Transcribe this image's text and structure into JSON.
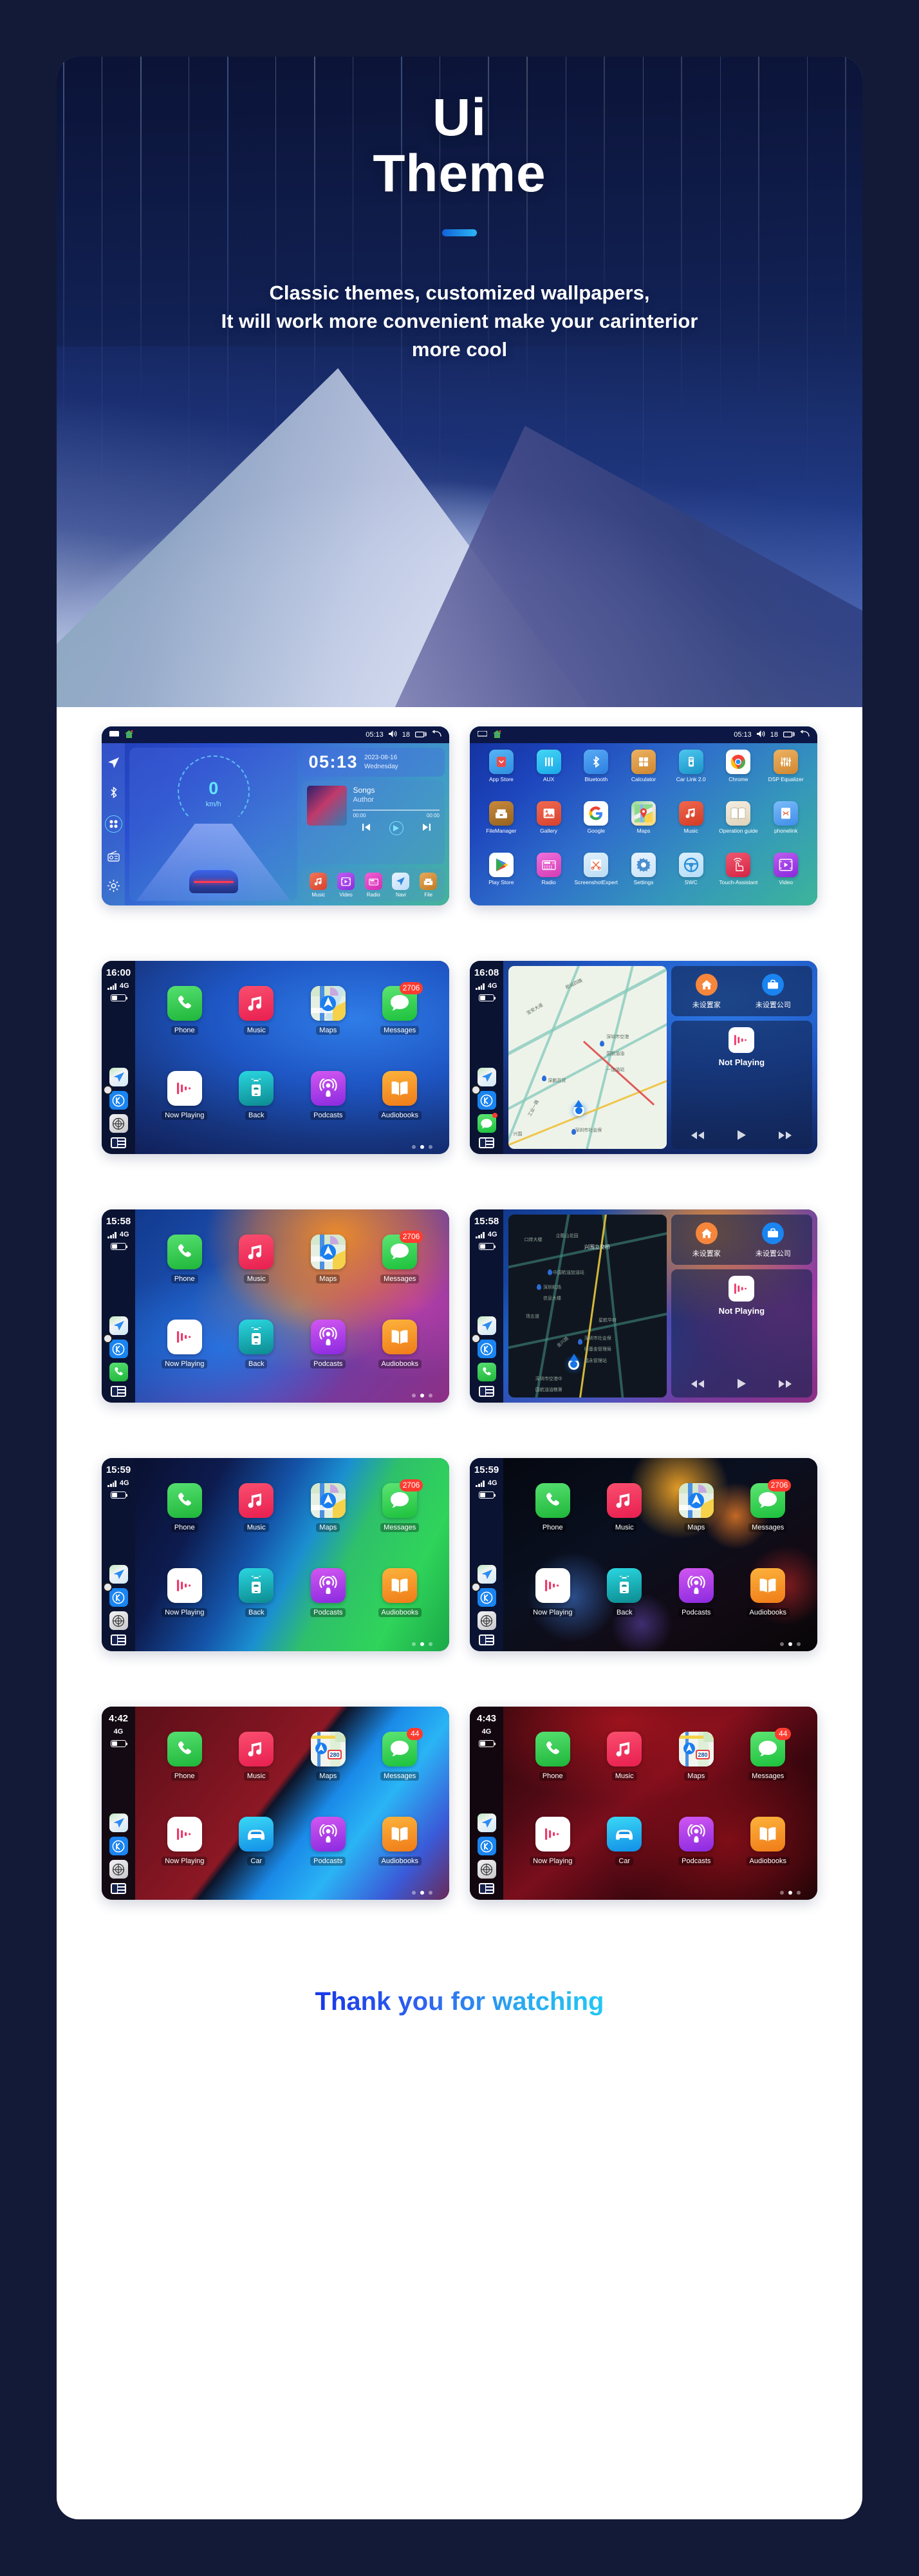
{
  "hero": {
    "title_line1": "Ui",
    "title_line2": "Theme",
    "subtitle_line1": "Classic themes, customized wallpapers,",
    "subtitle_line2": "It will work more convenient make your carinterior",
    "subtitle_line3": "more cool"
  },
  "headunit": {
    "status": {
      "time": "05:13",
      "volume": "18"
    },
    "gauge": {
      "speed": "0",
      "unit": "km/h"
    },
    "clock": {
      "time": "05:13",
      "date": "2023-08-16",
      "weekday": "Wednesday"
    },
    "music": {
      "title": "Songs",
      "artist": "Author",
      "elapsed": "00:00",
      "total": "00:00"
    },
    "dock": [
      {
        "label": "Music",
        "icon": "music-note-icon",
        "color": "#e8543c"
      },
      {
        "label": "Video",
        "icon": "video-icon",
        "color": "#a23ce8"
      },
      {
        "label": "Radio",
        "icon": "radio-icon",
        "color": "#e83cc8"
      },
      {
        "label": "Navi",
        "icon": "navigation-icon",
        "color": "#cfe9ff"
      },
      {
        "label": "File",
        "icon": "file-box-icon",
        "color": "#d8923c"
      }
    ]
  },
  "appgrid": {
    "status": {
      "time": "05:13",
      "volume": "18"
    },
    "apps": [
      {
        "label": "App Store",
        "icon": "app-store-icon",
        "color": "#4aa8f0"
      },
      {
        "label": "AUX",
        "icon": "aux-icon",
        "color": "#2ec4f0"
      },
      {
        "label": "Bluetooth",
        "icon": "bluetooth-icon",
        "color": "#3e9ef5"
      },
      {
        "label": "Calculator",
        "icon": "calculator-icon",
        "color": "#e09a47"
      },
      {
        "label": "Car Link 2.0",
        "icon": "car-link-icon",
        "color": "#35b7e8"
      },
      {
        "label": "Chrome",
        "icon": "chrome-icon",
        "color": "#ffffff"
      },
      {
        "label": "DSP Equalizer",
        "icon": "equalizer-icon",
        "color": "#e09a47"
      },
      {
        "label": "FileManager",
        "icon": "file-manager-icon",
        "color": "#b5762e"
      },
      {
        "label": "Gallery",
        "icon": "gallery-icon",
        "color": "#e8503c"
      },
      {
        "label": "Google",
        "icon": "google-icon",
        "color": "#ffffff"
      },
      {
        "label": "Maps",
        "icon": "maps-icon",
        "color": "#ffffff"
      },
      {
        "label": "Music",
        "icon": "music-icon",
        "color": "#e8503c"
      },
      {
        "label": "Operation guide",
        "icon": "book-icon",
        "color": "#efe7d8"
      },
      {
        "label": "phonelink",
        "icon": "phonelink-icon",
        "color": "#5aa8f5"
      },
      {
        "label": "Play Store",
        "icon": "play-store-icon",
        "color": "#ffffff"
      },
      {
        "label": "Radio",
        "icon": "radio-icon",
        "color": "#e85ad0"
      },
      {
        "label": "ScreenshotExpert",
        "icon": "screenshot-icon",
        "color": "#ffffff"
      },
      {
        "label": "Settings",
        "icon": "settings-gear-icon",
        "color": "#e6f2ff"
      },
      {
        "label": "SWC",
        "icon": "steering-wheel-icon",
        "color": "#cfeaff"
      },
      {
        "label": "Touch-Assistant",
        "icon": "touch-icon",
        "color": "#e8415c"
      },
      {
        "label": "Video",
        "icon": "video-icon",
        "color": "#a244e8"
      }
    ]
  },
  "carplay_home_labels": {
    "row1": [
      "Phone",
      "Music",
      "Maps",
      "Messages"
    ],
    "row2_back": [
      "Now Playing",
      "Back",
      "Podcasts",
      "Audiobooks"
    ],
    "row2_car": [
      "Now Playing",
      "Car",
      "Podcasts",
      "Audiobooks"
    ]
  },
  "carplay_dash_labels": {
    "home": "未设置家",
    "work": "未设置公司",
    "not_playing": "Not Playing"
  },
  "screens": [
    {
      "id": "carplay-home-blue",
      "time": "16:00",
      "network": "4G",
      "badge": "2706",
      "wallpaper": "blue-swirl",
      "second_label": "Back",
      "active_dot": 1
    },
    {
      "id": "carplay-dash-light",
      "time": "16:08",
      "network": "4G",
      "wallpaper": "blue-swirl",
      "map_theme": "light",
      "map_labels": [
        "航站四路",
        "宝安大道",
        "深圳市空港",
        "国航油油",
        "一加油站",
        "深鹏百货",
        "工业一路",
        "兴围",
        "深圳市社会保",
        "险基金管理局"
      ]
    },
    {
      "id": "carplay-home-rainbow",
      "time": "15:58",
      "network": "4G",
      "badge": "2706",
      "wallpaper": "rainbow-blur",
      "second_label": "Back",
      "active_dot": 1
    },
    {
      "id": "carplay-dash-dark",
      "time": "15:58",
      "network": "4G",
      "wallpaper": "rainbow-blur",
      "map_theme": "dark",
      "map_labels": [
        "口岸大楼",
        "企鹅山花园",
        "兴围立交桥",
        "中国航油加油站",
        "深圳机场",
        "信息大楼",
        "场五道",
        "金兴路",
        "星航华府",
        "深圳市社会保",
        "险基金管理局",
        "福永管理站",
        "深圳市空港中",
        "国航油油粮第"
      ]
    },
    {
      "id": "carplay-home-greenblue",
      "time": "15:59",
      "network": "4G",
      "badge": "2706",
      "wallpaper": "green-blue-diagonal",
      "second_label": "Back",
      "active_dot": 1
    },
    {
      "id": "carplay-home-bokeh",
      "time": "15:59",
      "network": "4G",
      "badge": "2706",
      "wallpaper": "dark-bokeh",
      "second_label": "Back",
      "active_dot": 1
    },
    {
      "id": "carplay-home-redblue",
      "time": "4:42",
      "network": "4G",
      "badge": "44",
      "wallpaper": "red-blue-diagonal",
      "second_label": "Car",
      "active_dot": 1
    },
    {
      "id": "carplay-home-darkred",
      "time": "4:43",
      "network": "4G",
      "badge": "44",
      "wallpaper": "dark-red",
      "second_label": "Car",
      "active_dot": 1
    }
  ],
  "footer": {
    "thanks": "Thank you for watching"
  },
  "colors": {
    "page_background": "#131a38",
    "accent_blue": "#1163d8",
    "accent_cyan": "#2bb6f5",
    "badge_red": "#ff3b30"
  }
}
